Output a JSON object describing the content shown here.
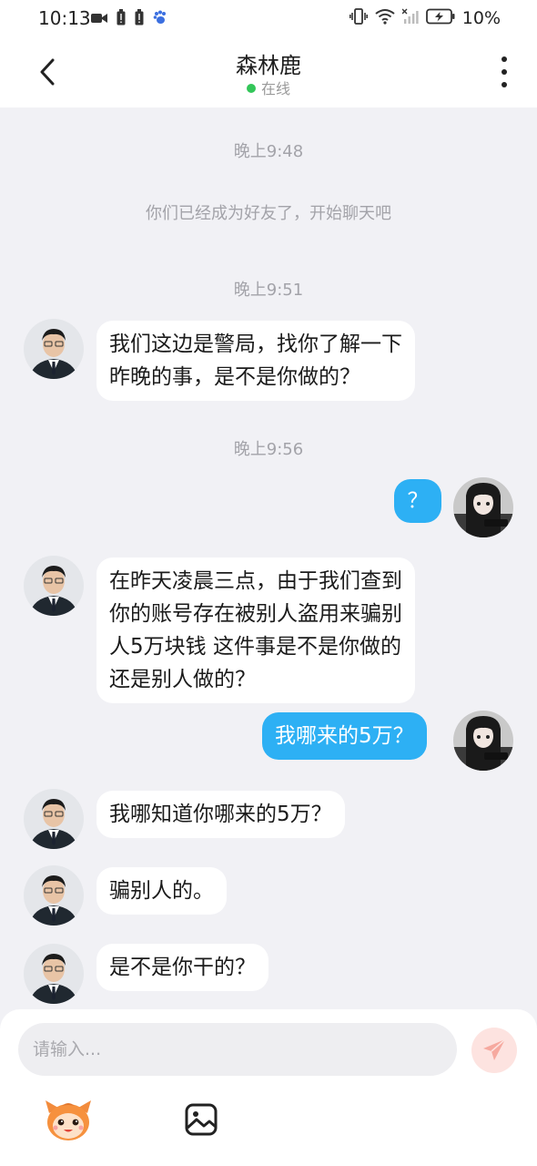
{
  "status_bar": {
    "time": "10:13",
    "battery_percent": "10%",
    "icons_left": [
      "video-icon",
      "battery-alert-icon",
      "battery-alert-icon",
      "paw-icon"
    ],
    "icons_right": [
      "vibrate-icon",
      "wifi-icon",
      "signal-off-icon",
      "battery-charging-icon"
    ]
  },
  "header": {
    "title": "森林鹿",
    "status": "在线",
    "status_color": "#33c659"
  },
  "chat": {
    "system_message": "你们已经成为好友了，开始聊天吧",
    "timestamps": [
      "晚上9:48",
      "晚上9:51",
      "晚上9:56"
    ],
    "messages": [
      {
        "side": "incoming",
        "text": "我们这边是警局，找你了解一下\n昨晚的事，是不是你做的？"
      },
      {
        "side": "outgoing",
        "text": "？"
      },
      {
        "side": "incoming",
        "text": "在昨天凌晨三点，由于我们查到\n你的账号存在被别人盗用来骗别\n人5万块钱 这件事是不是你做的\n还是别人做的？"
      },
      {
        "side": "outgoing",
        "text": "我哪来的5万？"
      },
      {
        "side": "incoming",
        "text": "我哪知道你哪来的5万？"
      },
      {
        "side": "incoming",
        "text": "骗别人的。"
      },
      {
        "side": "incoming",
        "text": "是不是你干的？"
      }
    ],
    "colors": {
      "outgoing_bubble": "#2db0f4",
      "incoming_bubble": "#ffffff",
      "background": "#f1f1f5"
    }
  },
  "input": {
    "placeholder": "请输入..."
  },
  "toolbar": {
    "items": [
      "emoji-mascot-icon",
      "image-icon",
      "send-icon"
    ]
  }
}
